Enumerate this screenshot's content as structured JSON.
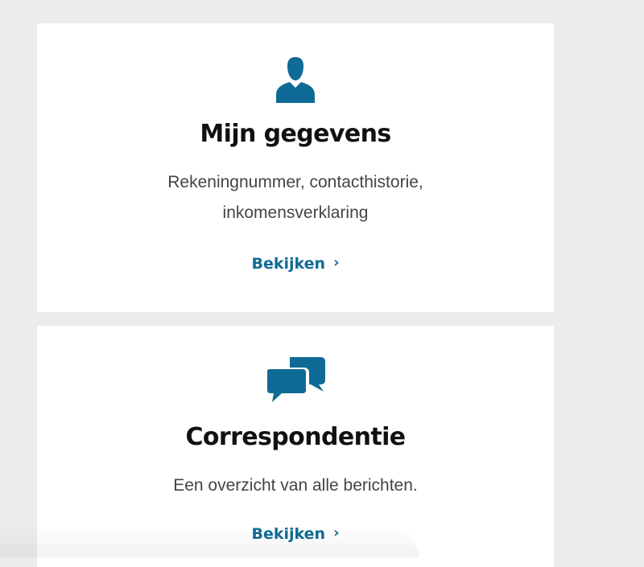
{
  "accent_color": "#0f6b95",
  "cards": [
    {
      "icon": "person-icon",
      "title": "Mijn gegevens",
      "description_lines": [
        "Rekeningnummer, contacthistorie,",
        "inkomensverklaring"
      ],
      "link_label": "Bekijken"
    },
    {
      "icon": "chat-bubbles-icon",
      "title": "Correspondentie",
      "description_lines": [
        "Een overzicht van alle berichten."
      ],
      "link_label": "Bekijken"
    }
  ]
}
